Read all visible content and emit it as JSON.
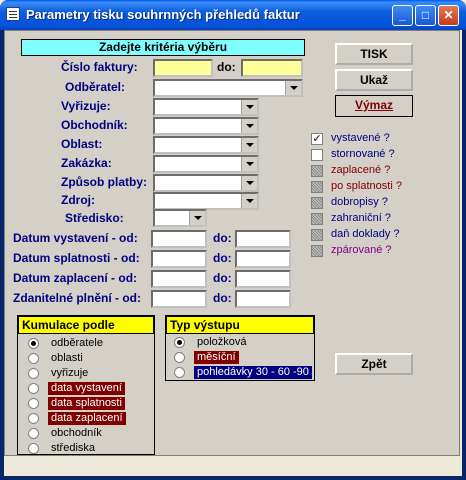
{
  "window": {
    "title": "Parametry tisku souhrnných přehledů faktur"
  },
  "header": {
    "label": "Zadejte kritéria výběru"
  },
  "fields": {
    "cislo_faktury": "Číslo faktury:",
    "do": "do:",
    "odberatel": "Odběratel:",
    "vyrizuje": "Vyřizuje:",
    "obchodnik": "Obchodník:",
    "oblast": "Oblast:",
    "zakazka": "Zakázka:",
    "zpusob_platby": "Způsob platby:",
    "zdroj": "Zdroj:",
    "stredisko": "Středisko:",
    "datum_vystaveni": "Datum vystavení - od:",
    "datum_splatnosti": "Datum splatnosti - od:",
    "datum_zaplaceni": "Datum zaplacení - od:",
    "zdanitelne_plneni": "Zdanitelné plnění - od:"
  },
  "buttons": {
    "tisk": "TISK",
    "ukaz": "Ukaž",
    "vymaz": "Výmaz",
    "zpet": "Zpět"
  },
  "checkboxes": [
    {
      "label": "vystavené ?",
      "state": "checked",
      "color": "#000080"
    },
    {
      "label": "stornované ?",
      "state": "unchecked",
      "color": "#000080"
    },
    {
      "label": "zaplacené ?",
      "state": "grey",
      "color": "#800000"
    },
    {
      "label": "po splatnosti ?",
      "state": "grey",
      "color": "#800000"
    },
    {
      "label": "dobropisy ?",
      "state": "grey",
      "color": "#000080"
    },
    {
      "label": "zahraniční ?",
      "state": "grey",
      "color": "#000080"
    },
    {
      "label": "daň doklady ?",
      "state": "grey",
      "color": "#000080"
    },
    {
      "label": "zpárované ?",
      "state": "grey",
      "color": "#800080"
    }
  ],
  "kumulace": {
    "title": "Kumulace podle",
    "options": [
      {
        "label": "odběratele",
        "selected": true,
        "style": "plain"
      },
      {
        "label": "oblasti",
        "selected": false,
        "style": "plain"
      },
      {
        "label": "vyřizuje",
        "selected": false,
        "style": "plain"
      },
      {
        "label": "data vystavení",
        "selected": false,
        "style": "dark"
      },
      {
        "label": "data splatnosti",
        "selected": false,
        "style": "dark"
      },
      {
        "label": "data zaplacení",
        "selected": false,
        "style": "dark"
      },
      {
        "label": "obchodník",
        "selected": false,
        "style": "plain"
      },
      {
        "label": "střediska",
        "selected": false,
        "style": "plain"
      }
    ]
  },
  "typ": {
    "title": "Typ výstupu",
    "options": [
      {
        "label": "položková",
        "selected": true,
        "style": "plain"
      },
      {
        "label": "měsíční",
        "selected": false,
        "style": "dark"
      },
      {
        "label": "pohledávky 30 - 60 -90",
        "selected": false,
        "style": "blue"
      }
    ]
  }
}
